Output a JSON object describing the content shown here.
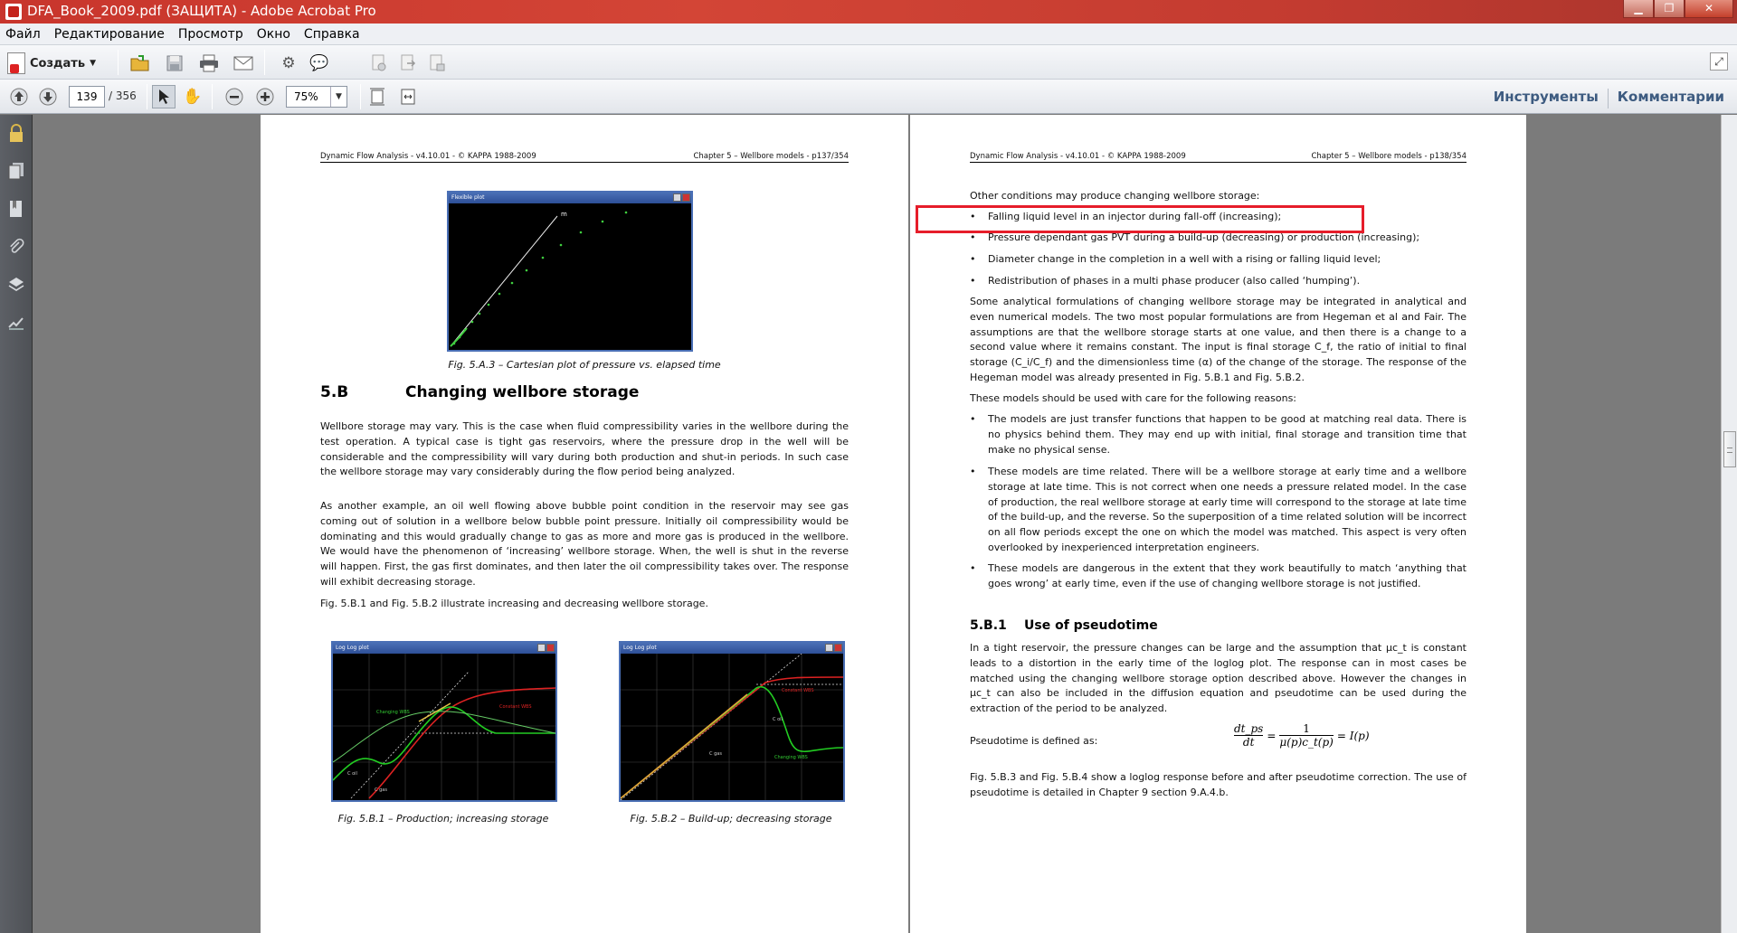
{
  "window": {
    "title": "DFA_Book_2009.pdf (ЗАЩИТА) - Adobe Acrobat Pro"
  },
  "menu": [
    "Файл",
    "Редактирование",
    "Просмотр",
    "Окно",
    "Справка"
  ],
  "toolbar": {
    "create_label": "Создать",
    "page_current": "139",
    "page_total": "/ 356",
    "zoom": "75%",
    "tools_link": "Инструменты",
    "comments_link": "Комментарии"
  },
  "page1": {
    "header_left": "Dynamic Flow Analysis - v4.10.01 - © KAPPA 1988-2009",
    "header_right": "Chapter 5 – Wellbore models - p137/354",
    "fig_a3_title": "Flexible plot",
    "fig_a3_marker": "m",
    "fig_a3_caption": "Fig. 5.A.3 – Cartesian plot of pressure vs. elapsed time",
    "section_num": "5.B",
    "section_title": "Changing wellbore storage",
    "para1": "Wellbore storage may vary. This is the case when fluid compressibility varies in the wellbore during the test operation. A typical case is tight gas reservoirs, where the pressure drop in the well will be considerable and the compressibility will vary during both production and shut-in periods. In such case the wellbore storage may vary considerably during the flow period being analyzed.",
    "para2": "As another example, an oil well flowing above bubble point condition in the reservoir may see gas coming out of solution in a wellbore below bubble point pressure. Initially oil compressibility would be dominating and this would gradually change to gas as more and more gas is produced in the wellbore. We would have the phenomenon of ‘increasing’ wellbore storage. When, the well is shut in the reverse will happen. First, the gas first dominates, and then later the oil compressibility takes over. The response will exhibit decreasing storage.",
    "para3": "Fig. 5.B.1 and Fig. 5.B.2 illustrate increasing and decreasing wellbore storage.",
    "fig_b1_title": "Log Log plot",
    "fig_b1_labels": [
      "Changing WBS",
      "Constant WBS",
      "C oil",
      "C gas"
    ],
    "fig_b1_caption": "Fig. 5.B.1 – Production; increasing storage",
    "fig_b2_title": "Log Log plot",
    "fig_b2_labels": [
      "Constant WBS",
      "C oil",
      "C gas",
      "Changing WBS"
    ],
    "fig_b2_caption": "Fig. 5.B.2 – Build-up; decreasing storage"
  },
  "page2": {
    "header_left": "Dynamic Flow Analysis - v4.10.01 - © KAPPA 1988-2009",
    "header_right": "Chapter 5 – Wellbore models - p138/354",
    "intro": "Other conditions may produce changing wellbore storage:",
    "conditions": [
      "Falling liquid level in an injector during fall-off (increasing);",
      "Pressure dependant gas PVT during a build-up (decreasing) or production (increasing);",
      "Diameter change in the completion in a well with a rising or falling liquid level;",
      "Redistribution of phases in a multi phase producer (also called ‘humping’)."
    ],
    "para1": "Some analytical formulations of changing wellbore storage may be integrated in analytical and even numerical models. The two most popular formulations are from Hegeman et al and Fair. The assumptions are that the wellbore storage starts at one value, and then there is a change to a second value where it remains constant. The input is final storage C_f, the ratio of initial to final storage (C_i/C_f) and the dimensionless time (α) of the change of the storage. The response of the Hegeman model was already presented in Fig. 5.B.1 and Fig. 5.B.2.",
    "para2": "These models should be used with care for the following reasons:",
    "reasons": [
      "The models are just transfer functions that happen to be good at matching real data. There is no physics behind them. They may end up with initial, final storage and transition time that make no physical sense.",
      "These models are time related. There will be a wellbore storage at early time and a wellbore storage at late time. This is not correct when one needs a pressure related model. In the case of production, the real wellbore storage at early time will correspond to the storage at late time of the build-up, and the reverse. So the superposition of a time related solution will be incorrect on all flow periods except the one on which the model was matched. This aspect is very often overlooked by inexperienced interpretation engineers.",
      "These models are dangerous in the extent that they work beautifully to match ‘anything that goes wrong’ at early time, even if the use of changing wellbore storage is not justified."
    ],
    "section_num": "5.B.1",
    "section_title": "Use of pseudotime",
    "para3": "In a tight reservoir, the pressure changes can be large and the assumption that μc_t is constant leads to a distortion in the early time of the loglog plot. The response can in most cases be matched using the changing wellbore storage option described above. However the changes in μc_t can also be included in the diffusion equation and pseudotime can be used during the extraction of the period to be analyzed.",
    "pseudo_label": "Pseudotime is defined as:",
    "formula": {
      "lhs_num": "dt_ps",
      "lhs_den": "dt",
      "rhs_num": "1",
      "rhs_den": "μ(p)c_t(p)",
      "result": "= I(p)"
    },
    "para4": "Fig. 5.B.3 and Fig. 5.B.4 show a loglog response before and after pseudotime correction. The use of pseudotime is detailed in Chapter 9 section 9.A.4.b."
  }
}
